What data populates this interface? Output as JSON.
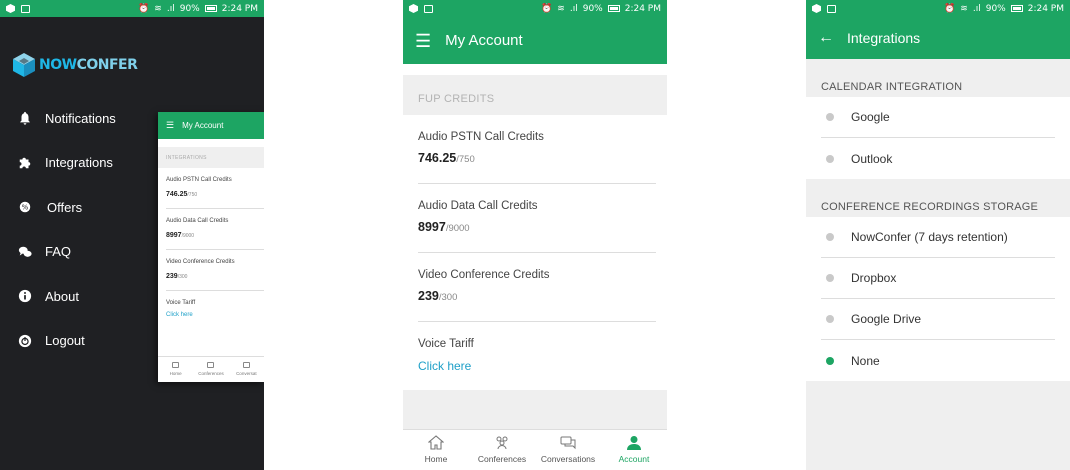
{
  "status_bar": {
    "battery": "90%",
    "time": "2:24 PM"
  },
  "drawer": {
    "logo": {
      "now": "NOW",
      "confer": "CONFER"
    },
    "items": [
      {
        "label": "Notifications",
        "icon": "bell-icon"
      },
      {
        "label": "Integrations",
        "icon": "puzzle-icon"
      },
      {
        "label": "Offers",
        "icon": "offer-icon"
      },
      {
        "label": "FAQ",
        "icon": "chat-bubbles-icon"
      },
      {
        "label": "About",
        "icon": "info-icon"
      },
      {
        "label": "Logout",
        "icon": "power-icon"
      }
    ]
  },
  "mini_preview": {
    "title": "My Account",
    "section": "INTEGRATIONS",
    "items": [
      {
        "title": "Audio PSTN Call Credits",
        "value": "746.25",
        "total": "/750"
      },
      {
        "title": "Audio Data Call Credits",
        "value": "8997",
        "total": "/9000"
      },
      {
        "title": "Video Conference Credits",
        "value": "239",
        "total": "/300"
      }
    ],
    "tariff_title": "Voice Tariff",
    "tariff_link": "Click here",
    "nav": [
      "Home",
      "Conferences",
      "Conversat"
    ]
  },
  "account": {
    "title": "My Account",
    "section": "FUP CREDITS",
    "credits": [
      {
        "title": "Audio PSTN Call Credits",
        "value": "746.25",
        "total": "/750"
      },
      {
        "title": "Audio Data Call Credits",
        "value": "8997",
        "total": "/9000"
      },
      {
        "title": "Video Conference Credits",
        "value": "239",
        "total": "/300"
      }
    ],
    "tariff_title": "Voice Tariff",
    "tariff_link": "Click here",
    "nav": [
      "Home",
      "Conferences",
      "Conversations",
      "Account"
    ],
    "active_tab": "Account",
    "accent": "#1da563"
  },
  "integrations": {
    "title": "Integrations",
    "calendar_header": "CALENDAR INTEGRATION",
    "calendar_options": [
      "Google",
      "Outlook"
    ],
    "storage_header": "CONFERENCE RECORDINGS STORAGE",
    "storage_options": [
      "NowConfer (7 days retention)",
      "Dropbox",
      "Google Drive",
      "None"
    ],
    "selected_storage": "None"
  }
}
